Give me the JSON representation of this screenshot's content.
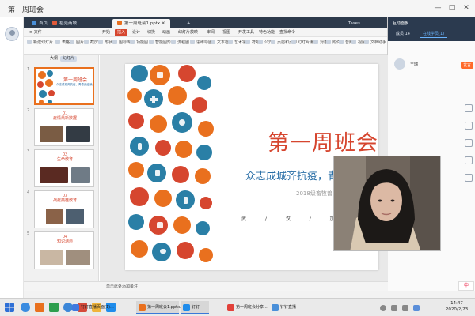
{
  "app": {
    "title": "第一周班会",
    "window_controls": [
      "—",
      "□",
      "✕"
    ]
  },
  "wps": {
    "tabs": [
      {
        "label": "首页",
        "color": "#4a90d9",
        "active": false
      },
      {
        "label": "稻壳商城",
        "color": "#e05a3a",
        "active": false
      },
      {
        "label": "第一周班会1.pptx",
        "color": "#e9701e",
        "active": true
      }
    ],
    "user_label": "Tases",
    "menu": [
      {
        "label": "≡ 文件",
        "active": false
      },
      {
        "label": "开始",
        "active": false
      },
      {
        "label": "插入",
        "active": true
      },
      {
        "label": "设计",
        "active": false
      },
      {
        "label": "切换",
        "active": false
      },
      {
        "label": "动画",
        "active": false
      },
      {
        "label": "幻灯片放映",
        "active": false
      },
      {
        "label": "审阅",
        "active": false
      },
      {
        "label": "视图",
        "active": false
      },
      {
        "label": "开发工具",
        "active": false
      },
      {
        "label": "特色功能",
        "active": false
      },
      {
        "label": "查找命令",
        "active": false
      }
    ],
    "ribbon": [
      "新建幻灯片",
      "表格",
      "图片",
      "截屏",
      "形状",
      "图标库",
      "功能图",
      "智能图形",
      "流程图",
      "思维导图",
      "文本框",
      "艺术字",
      "符号",
      "公式",
      "页眉和页脚",
      "幻灯片编号",
      "对象",
      "附件",
      "音频",
      "视频",
      "文档助手"
    ],
    "panel_tabs": [
      {
        "label": "大纲",
        "active": false
      },
      {
        "label": "幻灯片",
        "active": true
      }
    ],
    "thumbnails": [
      {
        "num": "1",
        "title": "第一周班会",
        "sub": "众志成城齐抗疫，青春战疫我先行"
      },
      {
        "num": "2",
        "title": "01\n疫情最新数据",
        "sub": ""
      },
      {
        "num": "3",
        "title": "02\n生命教育",
        "sub": ""
      },
      {
        "num": "4",
        "title": "03\n战疫英雄教育",
        "sub": ""
      },
      {
        "num": "5",
        "title": "04\n知识测验",
        "sub": ""
      }
    ],
    "status_note": "单击此处添加备注"
  },
  "slide": {
    "title": "第一周班会",
    "subtitle": "众志成城齐抗疫，青",
    "class_line": "2018级畜牧兽",
    "footer": "武 / 汉 / 加 / 油"
  },
  "right_panel": {
    "title": "互动面板",
    "tabs": [
      {
        "label": "成员 14",
        "active": false
      },
      {
        "label": "在线学员(1)",
        "active": true
      }
    ],
    "member_name": "王瑞",
    "member_badge": "发言"
  },
  "taskbar": {
    "apps": [
      {
        "label": "钉钉直播页面(1)...",
        "color": "#3f79e0",
        "active": false
      },
      {
        "label": "第一周班会1.pptx...",
        "color": "#e9701e",
        "active": true
      },
      {
        "label": "钉钉",
        "color": "#1f8ceb",
        "active": true
      },
      {
        "label": "第一周班会分享...",
        "color": "#e2413a",
        "active": false
      },
      {
        "label": "钉钉直播",
        "color": "#4a90d9",
        "active": false
      }
    ],
    "time": "14:47",
    "date": "2020/2/23",
    "sogou_label": "中"
  },
  "colors": {
    "accent_red": "#d6462f",
    "accent_blue": "#2a6fa7",
    "tab_orange": "#e9701e"
  }
}
